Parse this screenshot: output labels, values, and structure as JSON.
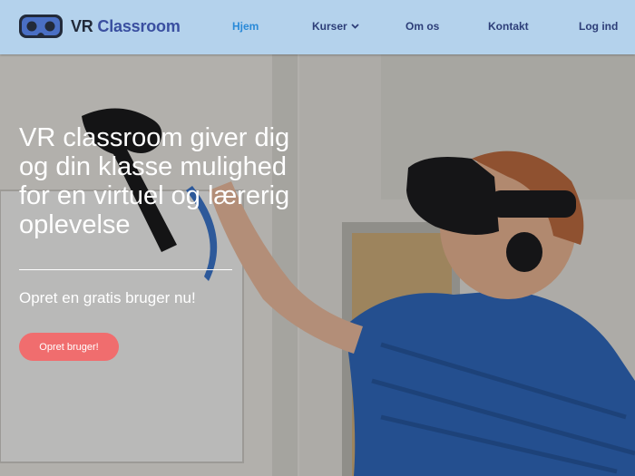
{
  "brand": {
    "part1": "VR",
    "part2": "Classroom"
  },
  "nav": {
    "home": "Hjem",
    "courses": "Kurser",
    "about": "Om os",
    "contact": "Kontakt",
    "login": "Log ind"
  },
  "hero": {
    "headline": "VR classroom giver dig og din klasse mulighed for en virtuel og lærerig oplevelse",
    "subtitle": "Opret en gratis bruger nu!",
    "cta_label": "Opret bruger!",
    "image_subject": "person wearing VR headset holding controller"
  },
  "colors": {
    "navbar_bg": "#b4d2ec",
    "nav_text": "#2d3e78",
    "nav_active": "#2a8ad8",
    "cta_bg": "#f06d6e",
    "hero_text": "#ffffff"
  },
  "icons": {
    "logo": "vr-headset-icon",
    "courses_dropdown": "chevron-down-icon"
  }
}
